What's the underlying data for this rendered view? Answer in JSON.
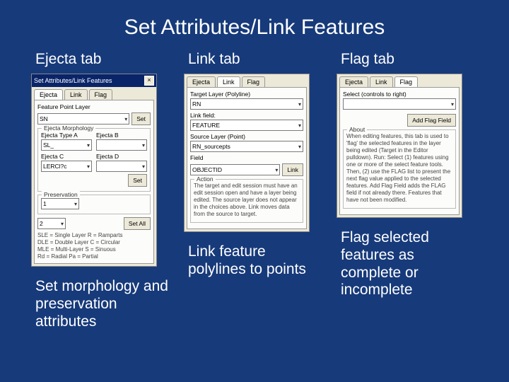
{
  "slide": {
    "title": "Set Attributes/Link Features"
  },
  "columns": [
    {
      "heading": "Ejecta tab",
      "caption": "Set morphology and preservation attributes"
    },
    {
      "heading": "Link tab",
      "caption": "Link feature polylines to points"
    },
    {
      "heading": "Flag tab",
      "caption": "Flag selected features as complete or incomplete"
    }
  ],
  "dialog": {
    "title": "Set Attributes/Link Features",
    "close": "×",
    "tabs": {
      "ejecta": "Ejecta",
      "link": "Link",
      "flag": "Flag"
    }
  },
  "ejecta": {
    "layer_label": "Feature Point Layer",
    "layer_value": "SN",
    "set_btn": "Set",
    "morph_caption": "Ejecta Morphology",
    "type_a_label": "Ejecta Type A",
    "type_a_value": "SL_",
    "type_b_label": "Ejecta B",
    "type_b_value": "",
    "type_c_label": "Ejecta C",
    "type_c_value": "LERCl?c",
    "type_d_label": "Ejecta D",
    "type_d_value": "",
    "set_btn2": "Set",
    "pres_caption": "Preservation",
    "pres_value": "1",
    "setall_btn": "Set All",
    "quick_num": "2",
    "legend": "SLE = Single Layer R = Ramparts\nDLE = Double Layer C = Circular\nMLE = Multi-Layer S = Sinuous\nRd = Radial Pa = Partial"
  },
  "link": {
    "panel_title": "",
    "target_label": "Target Layer (Polyline)",
    "target_value": "RN",
    "link_field_label": "Link field:",
    "link_field_value": "FEATURE",
    "source_label": "Source Layer (Point)",
    "source_value": "RN_sourcepts",
    "field_label": "Field",
    "field_value": "OBJECTID",
    "link_btn": "Link",
    "action_caption": "Action",
    "action_text": "The target and edit session must have an edit session open and have a layer being edited. The source layer does not appear in the choices above. Link moves data from the source to target."
  },
  "flag": {
    "caption": "Select (controls to right)",
    "dd_value": "",
    "btn_add": "Add Flag Field",
    "about_caption": "About",
    "about_text": "When editing features, this tab is used to 'flag' the selected features in the layer being edited (Target in the Editor pulldown). Run: Select (1) features using one or more of the select feature tools. Then, (2) use the FLAG list to present the next flag value applied to the selected features. Add Flag Field adds the FLAG field if not already there. Features that have not been modified."
  }
}
